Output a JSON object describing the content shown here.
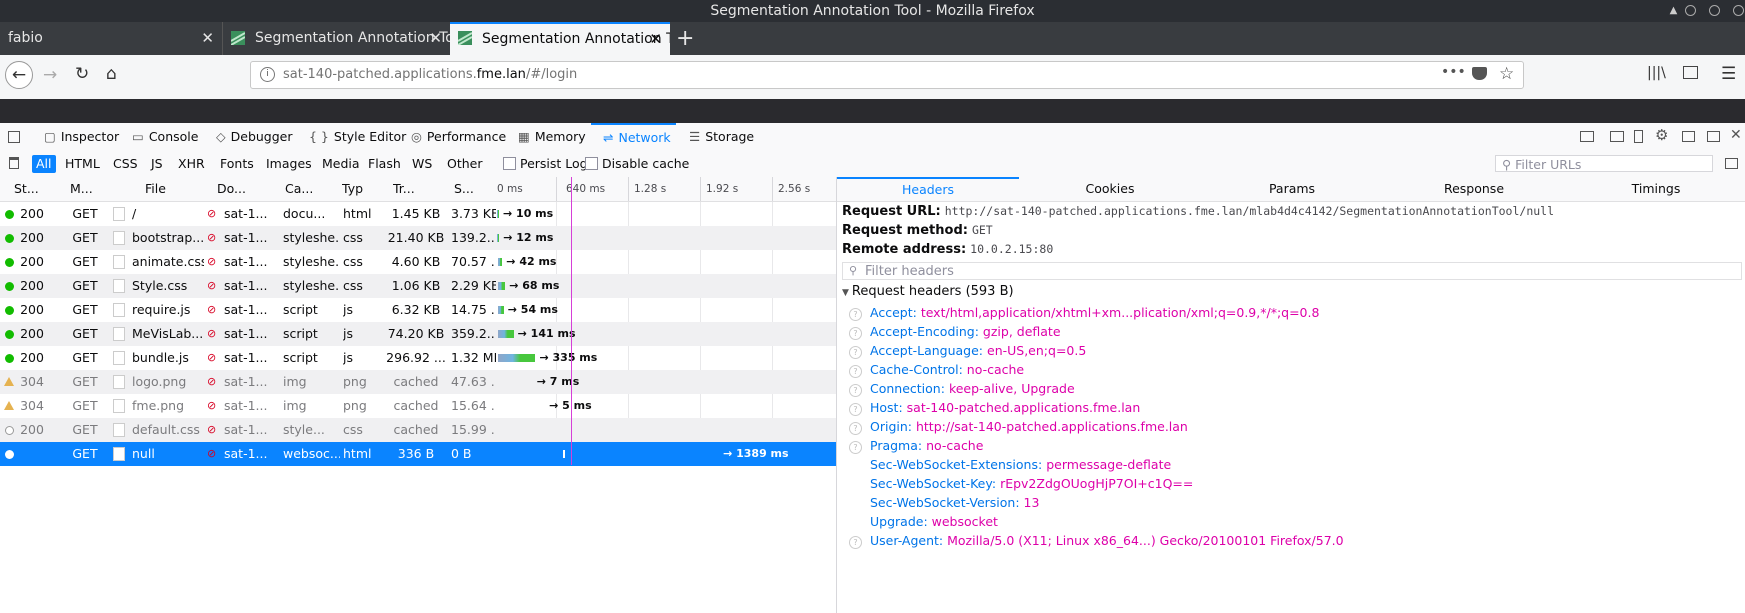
{
  "window": {
    "title": "Segmentation Annotation Tool - Mozilla Firefox"
  },
  "tabs": [
    {
      "label": "fabio",
      "close": "✕"
    },
    {
      "label": "Segmentation Annotation To",
      "close": "✕"
    },
    {
      "label": "Segmentation Annotation To",
      "close": "✕"
    }
  ],
  "nav": {
    "url_prefix": "sat-140-patched.applications.",
    "url_domain": "fme.lan",
    "url_suffix": "/#/login"
  },
  "devtools": {
    "tabs": [
      "Inspector",
      "Console",
      "Debugger",
      "Style Editor",
      "Performance",
      "Memory",
      "Network",
      "Storage"
    ],
    "tab_icons": [
      "inspector-icon",
      "console-icon",
      "debugger-icon",
      "style-editor-icon",
      "performance-icon",
      "memory-icon",
      "network-icon",
      "storage-icon"
    ],
    "tab_glyphs": [
      "▢",
      "▭",
      "◇",
      "{ }",
      "◎",
      "▦",
      "⇌",
      "☰"
    ],
    "selected_tab": "Network"
  },
  "filters": {
    "types": [
      "All",
      "HTML",
      "CSS",
      "JS",
      "XHR",
      "Fonts",
      "Images",
      "Media",
      "Flash",
      "WS",
      "Other"
    ],
    "persist_logs": "Persist Logs",
    "disable_cache": "Disable cache",
    "filter_placeholder": "Filter URLs"
  },
  "columns": [
    "St...",
    "M...",
    "File",
    "Do...",
    "Ca...",
    "Typ",
    "Tr...",
    "S...",
    "0 ms"
  ],
  "timeline_ticks": [
    "640 ms",
    "1.28 s",
    "1.92 s",
    "2.56 s"
  ],
  "requests": [
    {
      "status": "200",
      "method": "GET",
      "file": "/",
      "domain": "sat-1...",
      "cause": "docu...",
      "type": "html",
      "transferred": "1.45 KB",
      "size": "3.73 KB",
      "time": "→ 10 ms",
      "state": "ok"
    },
    {
      "status": "200",
      "method": "GET",
      "file": "bootstrap....",
      "domain": "sat-1...",
      "cause": "styleshe...",
      "type": "css",
      "transferred": "21.40 KB",
      "size": "139.2...",
      "time": "→ 12 ms",
      "state": "ok"
    },
    {
      "status": "200",
      "method": "GET",
      "file": "animate.css",
      "domain": "sat-1...",
      "cause": "styleshe...",
      "type": "css",
      "transferred": "4.60 KB",
      "size": "70.57 ...",
      "time": "→ 42 ms",
      "state": "ok"
    },
    {
      "status": "200",
      "method": "GET",
      "file": "Style.css",
      "domain": "sat-1...",
      "cause": "styleshe...",
      "type": "css",
      "transferred": "1.06 KB",
      "size": "2.29 KB",
      "time": "→ 68 ms",
      "state": "ok"
    },
    {
      "status": "200",
      "method": "GET",
      "file": "require.js",
      "domain": "sat-1...",
      "cause": "script",
      "type": "js",
      "transferred": "6.32 KB",
      "size": "14.75 ...",
      "time": "→ 54 ms",
      "state": "ok"
    },
    {
      "status": "200",
      "method": "GET",
      "file": "MeVisLab....",
      "domain": "sat-1...",
      "cause": "script",
      "type": "js",
      "transferred": "74.20 KB",
      "size": "359.2...",
      "time": "→ 141 ms",
      "state": "ok"
    },
    {
      "status": "200",
      "method": "GET",
      "file": "bundle.js",
      "domain": "sat-1...",
      "cause": "script",
      "type": "js",
      "transferred": "296.92 ...",
      "size": "1.32 MB",
      "time": "→ 335 ms",
      "state": "ok"
    },
    {
      "status": "304",
      "method": "GET",
      "file": "logo.png",
      "domain": "sat-1...",
      "cause": "img",
      "type": "png",
      "transferred": "cached",
      "size": "47.63 ...",
      "time": "→ 7 ms",
      "state": "cached"
    },
    {
      "status": "304",
      "method": "GET",
      "file": "fme.png",
      "domain": "sat-1...",
      "cause": "img",
      "type": "png",
      "transferred": "cached",
      "size": "15.64 ...",
      "time": "→ 5 ms",
      "state": "cached"
    },
    {
      "status": "200",
      "method": "GET",
      "file": "default.css",
      "domain": "sat-1...",
      "cause": "style...",
      "type": "css",
      "transferred": "cached",
      "size": "15.99 ...",
      "time": "",
      "state": "cached200"
    },
    {
      "status": "",
      "method": "GET",
      "file": "null",
      "domain": "sat-1...",
      "cause": "websoc...",
      "type": "html",
      "transferred": "336 B",
      "size": "0 B",
      "time": "→ 1389 ms",
      "state": "selected"
    }
  ],
  "details": {
    "tabs": [
      "Headers",
      "Cookies",
      "Params",
      "Response",
      "Timings"
    ],
    "request_url_label": "Request URL:",
    "request_url": "http://sat-140-patched.applications.fme.lan/mlab4d4c4142/SegmentationAnnotationTool/null",
    "request_method_label": "Request method:",
    "request_method": "GET",
    "remote_address_label": "Remote address:",
    "remote_address": "10.0.2.15:80",
    "filter_headers": "Filter headers",
    "request_headers_title": "Request headers (593 B)",
    "headers": [
      {
        "key": "Accept:",
        "value": "text/html,application/xhtml+xm...plication/xml;q=0.9,*/*;q=0.8",
        "help": true
      },
      {
        "key": "Accept-Encoding:",
        "value": "gzip, deflate",
        "help": true
      },
      {
        "key": "Accept-Language:",
        "value": "en-US,en;q=0.5",
        "help": true
      },
      {
        "key": "Cache-Control:",
        "value": "no-cache",
        "help": true
      },
      {
        "key": "Connection:",
        "value": "keep-alive, Upgrade",
        "help": true
      },
      {
        "key": "Host:",
        "value": "sat-140-patched.applications.fme.lan",
        "help": true
      },
      {
        "key": "Origin:",
        "value": "http://sat-140-patched.applications.fme.lan",
        "help": true
      },
      {
        "key": "Pragma:",
        "value": "no-cache",
        "help": true
      },
      {
        "key": "Sec-WebSocket-Extensions:",
        "value": "permessage-deflate",
        "help": false
      },
      {
        "key": "Sec-WebSocket-Key:",
        "value": "rEpv2ZdgOUogHjP7OI+c1Q==",
        "help": false
      },
      {
        "key": "Sec-WebSocket-Version:",
        "value": "13",
        "help": false
      },
      {
        "key": "Upgrade:",
        "value": "websocket",
        "help": false
      },
      {
        "key": "User-Agent:",
        "value": "Mozilla/5.0 (X11; Linux x86_64...) Gecko/20100101 Firefox/57.0",
        "help": true
      }
    ]
  },
  "colors": {
    "accent": "#0a84ff",
    "ok": "#12bc00",
    "warn": "#e5b250",
    "header_key": "#0074e8",
    "header_value": "#dd00a9"
  }
}
